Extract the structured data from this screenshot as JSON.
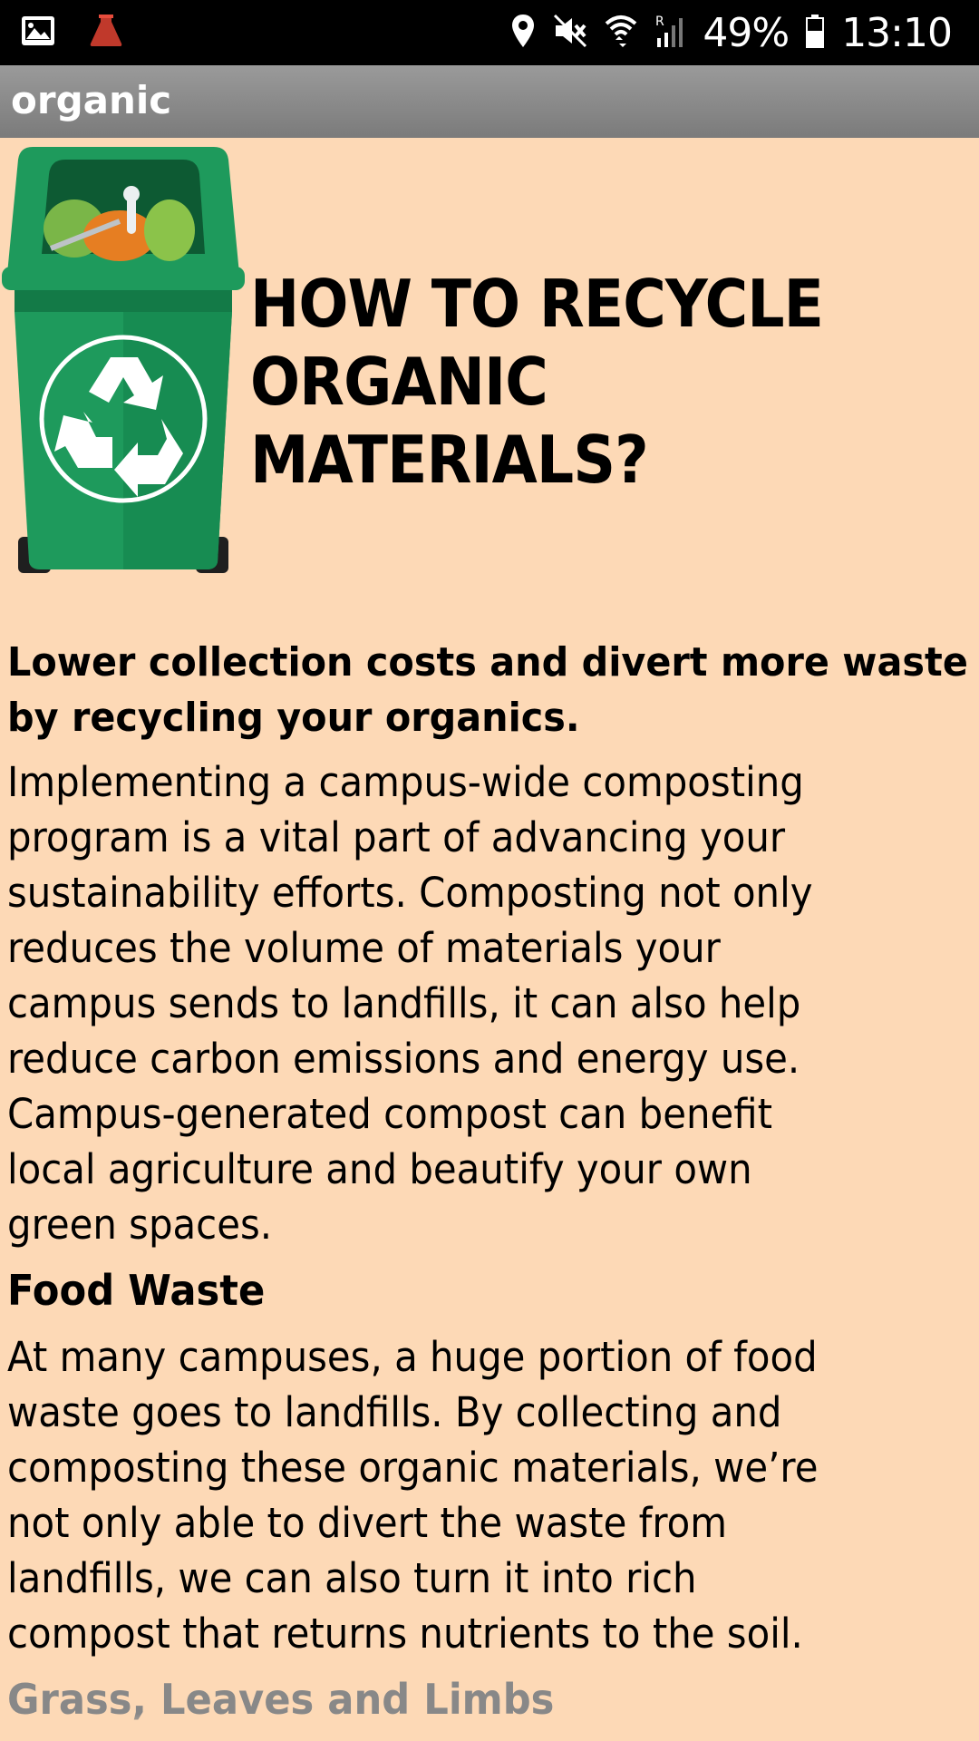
{
  "status_bar": {
    "battery": "49%",
    "time": "13:10",
    "icons": [
      "gallery-icon",
      "app-notification-icon",
      "location-icon",
      "mute-icon",
      "wifi-icon",
      "roaming-signal-icon",
      "battery-icon"
    ]
  },
  "app_bar": {
    "title": "organic"
  },
  "hero": {
    "title_line1": "HOW TO RECYCLE",
    "title_line2": "ORGANIC MATERIALS?",
    "image": "green-recycle-bin-with-food-waste"
  },
  "article": {
    "lead": "Lower collection costs and divert more waste by recycling your organics.",
    "paragraph1": "Implementing a campus-wide composting program is a vital part of advancing your sustainability efforts. Composting not only reduces the volume of materials your campus sends to landfills, it can also help reduce carbon emissions and energy use. Campus-generated compost can benefit local agriculture and beautify your own green spaces.",
    "section1_heading": "Food Waste",
    "section1_text": "At many campuses, a huge portion of food waste goes to landfills. By collecting and composting these organic materials, we’re not only able to divert the waste from landfills, we can also turn it into rich compost that returns nutrients to the soil.",
    "section2_heading": "Grass, Leaves and Limbs"
  },
  "colors": {
    "background": "#fdd9b6",
    "app_bar": "#8a8a8a",
    "bin_green": "#1e9a5c"
  }
}
